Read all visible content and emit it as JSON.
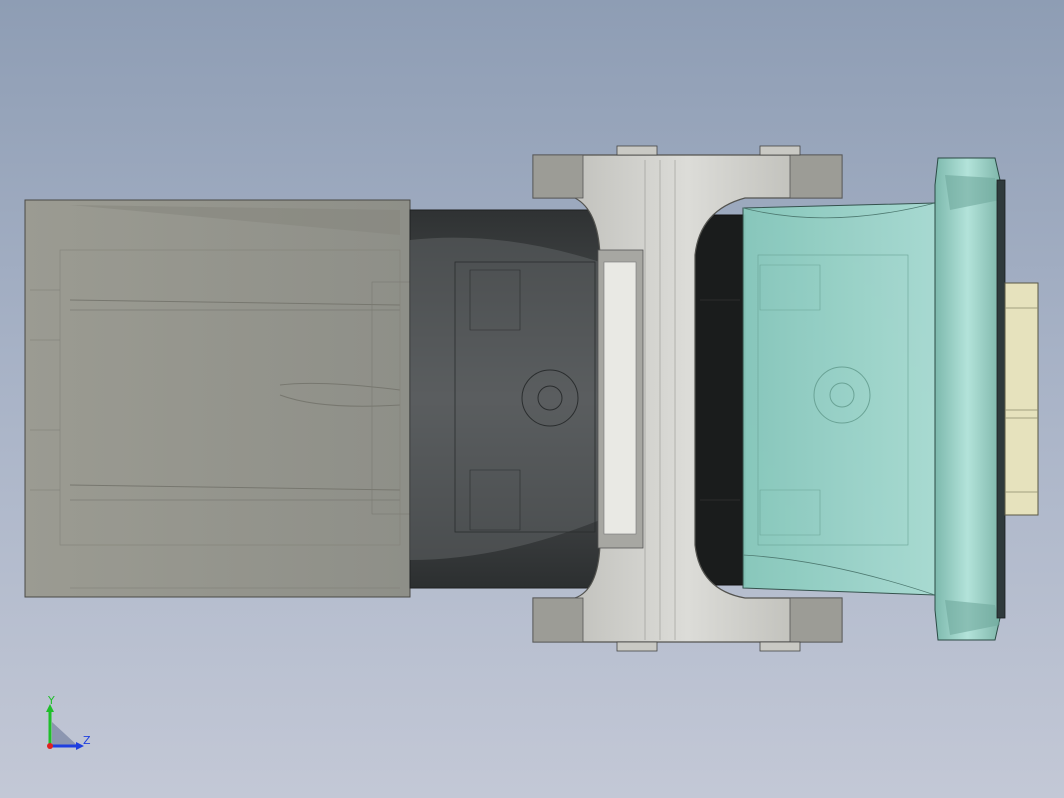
{
  "viewport": {
    "background_top": "#8e9db4",
    "background_bottom": "#c3c8d6"
  },
  "model": {
    "parts": [
      {
        "name": "housing-block",
        "color": "#9a9a90"
      },
      {
        "name": "dark-insert",
        "color": "#3e4142"
      },
      {
        "name": "clamp-bracket",
        "color": "#c7c7c2"
      },
      {
        "name": "transparent-cap",
        "color": "#9fd6cb"
      },
      {
        "name": "nut",
        "color": "#e6e2bd"
      }
    ]
  },
  "triad": {
    "y_label": "Y",
    "z_label": "Z",
    "y_color": "#1fbf2a",
    "z_color": "#1f3fe0",
    "x_color": "#e02020"
  }
}
